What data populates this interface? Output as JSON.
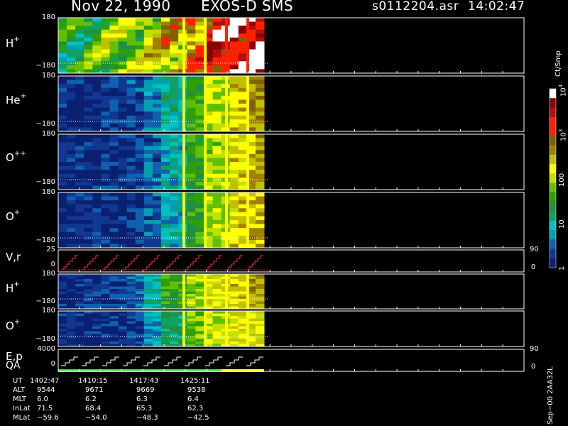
{
  "header": {
    "date": "Nov 22, 1990",
    "instrument": "EXOS-D SMS",
    "file": "s0112204.asr",
    "time": "14:02:47"
  },
  "panels": [
    {
      "id": "h-plus-1",
      "name": "H",
      "sup": "+",
      "top_tick": "180",
      "bottom_tick": "−180"
    },
    {
      "id": "he-plus",
      "name": "He",
      "sup": "+",
      "top_tick": "180",
      "bottom_tick": "−180"
    },
    {
      "id": "o-plusplus",
      "name": "O",
      "sup": "++",
      "top_tick": "180",
      "bottom_tick": "−180"
    },
    {
      "id": "o-plus-1",
      "name": "O",
      "sup": "+",
      "top_tick": "180",
      "bottom_tick": "−180"
    },
    {
      "id": "vr",
      "name": "V,r",
      "sup": "",
      "top_tick": "25",
      "bottom_tick": "0",
      "right_top": "90",
      "right_bottom": "0"
    },
    {
      "id": "h-plus-2",
      "name": "H",
      "sup": "+",
      "top_tick": "180",
      "bottom_tick": "−180"
    },
    {
      "id": "o-plus-2",
      "name": "O",
      "sup": "+",
      "top_tick": "180",
      "bottom_tick": "−180"
    },
    {
      "id": "ep",
      "name": "E,p",
      "sup": "",
      "top_tick": "4000",
      "bottom_tick": "0",
      "right_top": "90",
      "right_bottom": "0"
    }
  ],
  "qa_label": "QA",
  "colorbar": {
    "unit": "Ct/Smp",
    "labels": [
      {
        "text": "10",
        "sup": "4",
        "value": 10000
      },
      {
        "text": "10",
        "sup": "3",
        "value": 1000
      },
      {
        "text": "100",
        "sup": "",
        "value": 100
      },
      {
        "text": "10",
        "sup": "",
        "value": 10
      },
      {
        "text": "1",
        "sup": "",
        "value": 1
      }
    ],
    "colors": [
      "#ffffff",
      "#8b0000",
      "#b01010",
      "#ff2000",
      "#ff2000",
      "#806000",
      "#a08000",
      "#c0c000",
      "#ffff00",
      "#c0e000",
      "#60c000",
      "#30a000",
      "#209040",
      "#10a060",
      "#00c0c0",
      "#00a0b0",
      "#1060b0",
      "#103890",
      "#0a2070"
    ]
  },
  "footer": {
    "rows": [
      {
        "label": "UT",
        "values": [
          "1402:47",
          "1410:15",
          "1417:43",
          "1425:11"
        ]
      },
      {
        "label": "ALT",
        "values": [
          "9544",
          "9671",
          "9669",
          "9538"
        ]
      },
      {
        "label": "MLT",
        "values": [
          "6.0",
          "6.2",
          "6.3",
          "6.4"
        ]
      },
      {
        "label": "InLat",
        "values": [
          "71.5",
          "68.4",
          "65.3",
          "62.3"
        ]
      },
      {
        "label": "MLat",
        "values": [
          "−59.6",
          "−54.0",
          "−48.3",
          "−42.5"
        ]
      }
    ],
    "version": "Sep−00 2AA32L"
  },
  "chart_data": {
    "type": "heatmap",
    "title": "Nov 22, 1990   EXOS-D SMS",
    "time_ticks": [
      "1402:47",
      "1410:15",
      "1417:43",
      "1425:11"
    ],
    "panels": [
      {
        "name": "H+",
        "ylim": [
          -180,
          180
        ],
        "intensity_profile": [
          0.35,
          0.4,
          0.45,
          0.5,
          0.55,
          0.6,
          0.7,
          0.85,
          0.9,
          0.95
        ]
      },
      {
        "name": "He+",
        "ylim": [
          -180,
          180
        ],
        "intensity_profile": [
          0.05,
          0.05,
          0.08,
          0.1,
          0.15,
          0.25,
          0.4,
          0.5,
          0.6,
          0.65
        ]
      },
      {
        "name": "O++",
        "ylim": [
          -180,
          180
        ],
        "intensity_profile": [
          0.05,
          0.05,
          0.06,
          0.08,
          0.12,
          0.22,
          0.38,
          0.48,
          0.58,
          0.62
        ]
      },
      {
        "name": "O+",
        "ylim": [
          -180,
          180
        ],
        "intensity_profile": [
          0.05,
          0.05,
          0.06,
          0.08,
          0.12,
          0.22,
          0.38,
          0.48,
          0.58,
          0.62
        ]
      },
      {
        "name": "V,r",
        "ylim": [
          0,
          25
        ],
        "right_ylim": [
          0,
          90
        ]
      },
      {
        "name": "H+",
        "ylim": [
          -180,
          180
        ],
        "intensity_profile": [
          0.05,
          0.06,
          0.08,
          0.12,
          0.25,
          0.38,
          0.48,
          0.55,
          0.6,
          0.65
        ]
      },
      {
        "name": "O+",
        "ylim": [
          -180,
          180
        ],
        "intensity_profile": [
          0.05,
          0.05,
          0.06,
          0.08,
          0.18,
          0.3,
          0.45,
          0.5,
          0.55,
          0.55
        ]
      },
      {
        "name": "E,p",
        "ylim": [
          0,
          4000
        ],
        "right_ylim": [
          0,
          90
        ]
      }
    ],
    "colorbar_range": [
      1,
      10000
    ],
    "colorbar_scale": "log"
  }
}
